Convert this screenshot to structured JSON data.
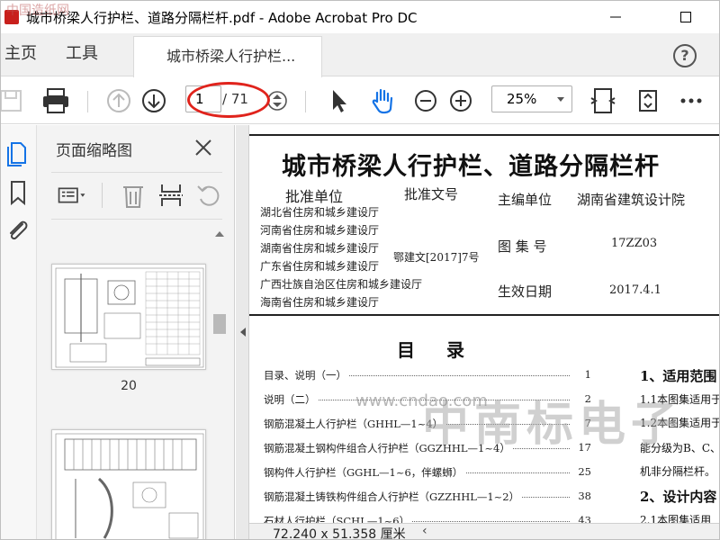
{
  "window": {
    "title": "城市桥梁人行护栏、道路分隔栏杆.pdf - Adobe Acrobat Pro DC",
    "corner_watermark": "中国造纸网"
  },
  "tabs": {
    "home": "主页",
    "tools": "工具",
    "document": "城市桥梁人行护栏..."
  },
  "toolbar": {
    "current_page": "1",
    "page_total": "/ 71",
    "zoom": "25%"
  },
  "thumbnails": {
    "title": "页面缩略图",
    "pages": [
      {
        "label": "20"
      },
      {
        "label": ""
      }
    ]
  },
  "document": {
    "title": "城市桥梁人行护栏、道路分隔栏杆",
    "approval_unit_label": "批准单位",
    "approval_doc_label": "批准文号",
    "editor_label": "主编单位",
    "editor_value": "湖南省建筑设计院",
    "atlas_no_label": "图 集 号",
    "atlas_no_value": "17ZZ03",
    "effective_label": "生效日期",
    "effective_value": "2017.4.1",
    "approval_doc_value": "鄂建文[2017]7号",
    "agencies": [
      "湖北省住房和城乡建设厅",
      "河南省住房和城乡建设厅",
      "湖南省住房和城乡建设厅",
      "广东省住房和城乡建设厅",
      "广西壮族自治区住房和城乡建设厅",
      "海南省住房和城乡建设厅"
    ],
    "toc_title": "目 录",
    "toc": [
      {
        "name": "目录、说明（一）",
        "page": "1"
      },
      {
        "name": "说明（二）",
        "page": "2"
      },
      {
        "name": "钢筋混凝土人行护栏（GHHL—1~4）",
        "page": "7"
      },
      {
        "name": "钢筋混凝土钢构件组合人行护栏（GGZHHL—1~4）",
        "page": "17"
      },
      {
        "name": "钢构件人行护栏（GGHL—1~6，伴螺蛳）",
        "page": "25"
      },
      {
        "name": "钢筋混凝土铸铁构件组合人行护栏（GZZHHL—1~2）",
        "page": "38"
      },
      {
        "name": "石材人行护栏（SCHL—1~6）",
        "page": "43"
      }
    ],
    "right_col": {
      "section1": "1、适用范围",
      "line1": "1.1本图集适用于",
      "line2": "1.2本图集适用于",
      "line3": "能分级为B、C、",
      "line4": "机非分隔栏杆。",
      "section2": "2、设计内容",
      "line5": "2.1本图集适用"
    },
    "watermark": "中南标电子",
    "watermark_url": "www.cndao.com"
  },
  "status": {
    "dimensions": "72.240 x 51.358 厘米"
  },
  "colors": {
    "accent_blue": "#1473e6",
    "highlight_ring": "#e0231c"
  }
}
